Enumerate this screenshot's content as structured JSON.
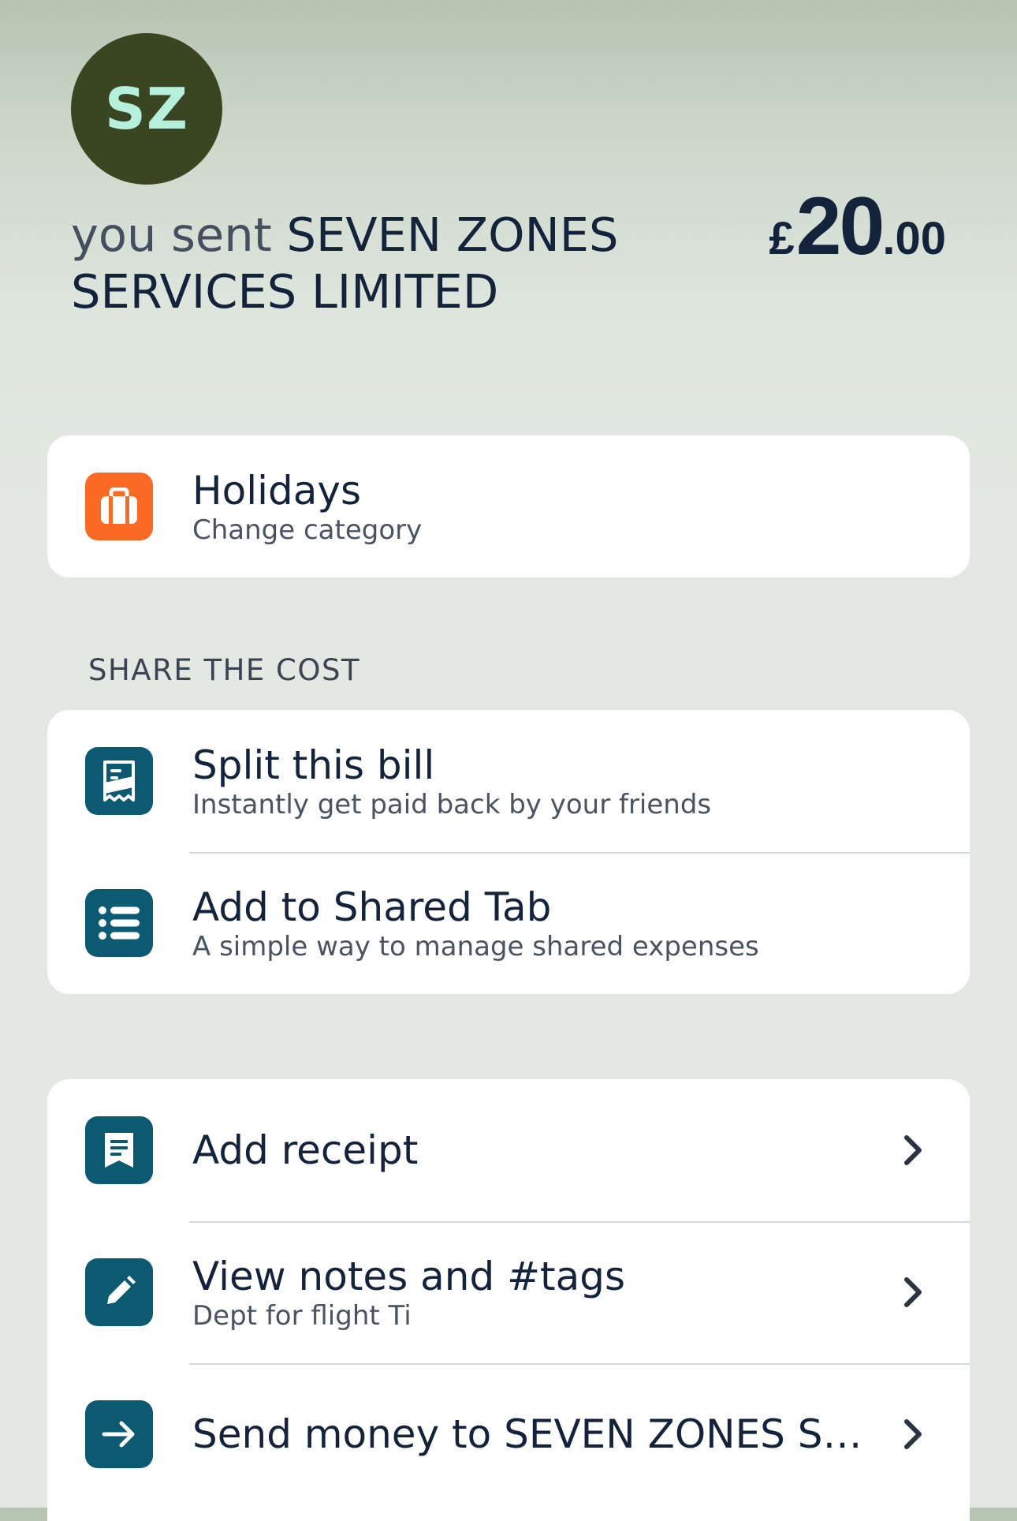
{
  "header": {
    "avatar_initials": "SZ",
    "sent_prefix": "you sent",
    "merchant_name": "SEVEN ZONES SERVICES LIMITED",
    "amount": {
      "currency": "£",
      "whole": "20",
      "fraction": ".00"
    }
  },
  "category_card": {
    "icon": "suitcase-icon",
    "title": "Holidays",
    "subtitle": "Change category"
  },
  "share_section": {
    "label": "SHARE THE COST",
    "items": [
      {
        "icon": "receipt-split-icon",
        "title": "Split this bill",
        "subtitle": "Instantly get paid back by your friends"
      },
      {
        "icon": "list-icon",
        "title": "Add to Shared Tab",
        "subtitle": "A simple way to manage shared expenses"
      }
    ]
  },
  "actions": [
    {
      "icon": "receipt-icon",
      "title": "Add receipt",
      "subtitle": ""
    },
    {
      "icon": "pencil-icon",
      "title": "View notes and #tags",
      "subtitle": "Dept for flight Ti"
    },
    {
      "icon": "arrow-right-icon",
      "title": "Send money to SEVEN ZONES SE…",
      "subtitle": ""
    }
  ],
  "colors": {
    "avatar_bg": "#3a4621",
    "avatar_text": "#b6f0dd",
    "category_icon_bg": "#fa6a22",
    "action_icon_bg": "#0b5a72",
    "text_primary": "#14233c"
  }
}
